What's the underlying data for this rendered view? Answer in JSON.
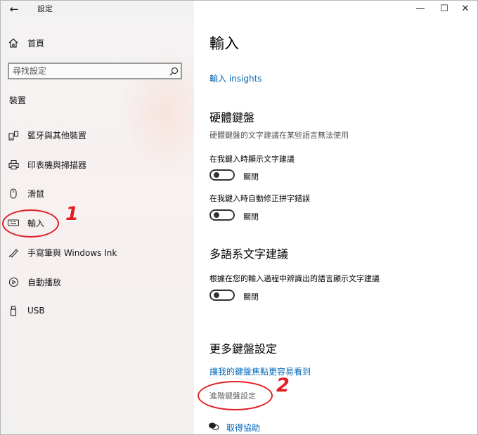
{
  "window": {
    "title": "設定",
    "minimize_glyph": "—",
    "maximize_glyph": "☐",
    "close_glyph": "✕"
  },
  "sidebar": {
    "home_label": "首頁",
    "search_placeholder": "尋找設定",
    "section_heading": "裝置",
    "items": [
      {
        "label": "藍牙與其他裝置",
        "icon": "bluetooth-devices-icon"
      },
      {
        "label": "印表機與掃描器",
        "icon": "printer-icon"
      },
      {
        "label": "滑鼠",
        "icon": "mouse-icon"
      },
      {
        "label": "輸入",
        "icon": "keyboard-icon"
      },
      {
        "label": "手寫筆與 Windows Ink",
        "icon": "pen-icon"
      },
      {
        "label": "自動播放",
        "icon": "autoplay-icon"
      },
      {
        "label": "USB",
        "icon": "usb-icon"
      }
    ]
  },
  "main": {
    "title": "輸入",
    "insights_link": "輸入 insights",
    "hardware_keyboard": {
      "heading": "硬體鍵盤",
      "description": "硬體鍵盤的文字建議在某些語言無法使用",
      "options": [
        {
          "label": "在我鍵入時顯示文字建議",
          "state": "關閉"
        },
        {
          "label": "在我鍵入時自動修正拼字錯誤",
          "state": "關閉"
        }
      ]
    },
    "multilingual": {
      "heading": "多語系文字建議",
      "option": {
        "label": "根據在您的輸入過程中辨識出的語言顯示文字建議",
        "state": "關閉"
      }
    },
    "more_settings": {
      "heading": "更多鍵盤設定",
      "focus_link": "讓我的鍵盤焦點更容易看到",
      "advanced_link": "進階鍵盤設定"
    },
    "help_label": "取得協助"
  },
  "annotations": {
    "one": "1",
    "two": "2"
  },
  "colors": {
    "accent": "#0067b8",
    "annotation": "#e01f24"
  }
}
